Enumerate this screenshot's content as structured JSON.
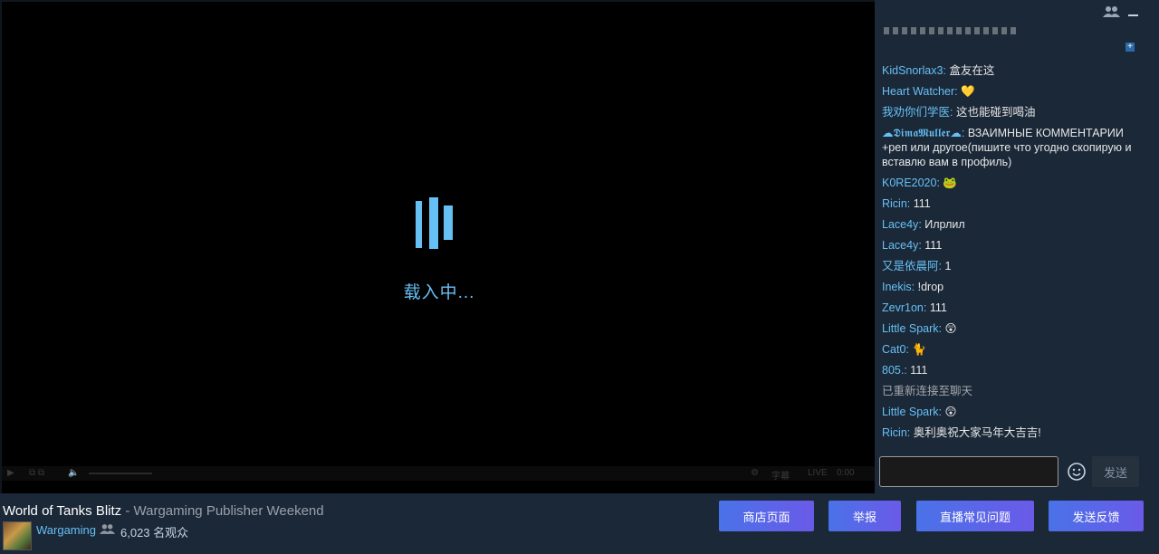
{
  "player": {
    "loading_text": "载入中...",
    "controls": {
      "subtitles_label": "字幕",
      "live_label": "LIVE",
      "time": "0:00"
    }
  },
  "chat": {
    "messages": [
      {
        "user": "KidSnorlax3",
        "text": "盒友在这"
      },
      {
        "user": "Heart Watcher",
        "text": "💛"
      },
      {
        "user": "我劝你们学医",
        "text": "这也能碰到喝油"
      },
      {
        "user": "☁𝕯𝖎𝖒𝖆𝕸𝖚𝖑𝖑𝖊𝖗☁",
        "text": "ВЗАИМНЫЕ КОММЕНТАРИИ +реп или другое(пишите что угодно скопирую и вставлю вам в профиль)"
      },
      {
        "user": "K0RE2020",
        "text": "🐸"
      },
      {
        "user": "Ricin",
        "text": "111"
      },
      {
        "user": "Lace4y",
        "text": "Илрлил"
      },
      {
        "user": "Lace4y",
        "text": "111"
      },
      {
        "user": "又是依晨阿",
        "text": "1"
      },
      {
        "user": "Inekis",
        "text": "!drop"
      },
      {
        "user": "Zevr1on",
        "text": "111"
      },
      {
        "user": "Little Spark",
        "text": "😲"
      },
      {
        "user": "Cat0",
        "text": "🐈"
      },
      {
        "user": "805.",
        "text": "111"
      },
      {
        "system": "已重新连接至聊天"
      },
      {
        "user": "Little Spark",
        "text": "😲"
      },
      {
        "user": "Ricin",
        "text": "奥利奥祝大家马年大吉吉!"
      }
    ],
    "input_value": "",
    "send_label": "发送"
  },
  "stream": {
    "game_title": "World of Tanks Blitz",
    "separator": " - ",
    "event_title": "Wargaming Publisher Weekend",
    "broadcaster": "Wargaming",
    "viewers": "6,023 名观众"
  },
  "actions": {
    "store_page": "商店页面",
    "report": "举报",
    "faq": "直播常见问题",
    "feedback": "发送反馈"
  },
  "colors": {
    "accent": "#66c0f4",
    "background": "#1b2838",
    "button_start": "#4a72e8",
    "button_end": "#6a5ae8"
  }
}
